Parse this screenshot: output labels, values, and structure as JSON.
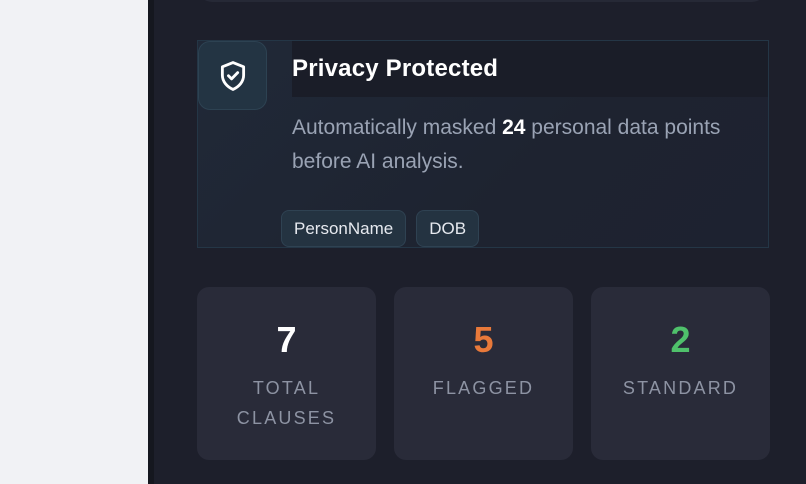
{
  "privacy": {
    "title": "Privacy Protected",
    "desc_prefix": "Automatically masked ",
    "count": "24",
    "desc_suffix": " personal data points before AI analysis.",
    "tags": [
      "PersonName",
      "DOB"
    ]
  },
  "stats": [
    {
      "value": "7",
      "label": "TOTAL CLAUSES",
      "color": "#ffffff"
    },
    {
      "value": "5",
      "label": "FLAGGED",
      "color": "#e8793a"
    },
    {
      "value": "2",
      "label": "STANDARD",
      "color": "#4fc16b"
    }
  ],
  "icons": {
    "privacy": "shield-check-icon"
  },
  "colors": {
    "panel_bg": "#1d1f2b",
    "accent_flagged": "#e8793a",
    "accent_standard": "#4fc16b"
  }
}
